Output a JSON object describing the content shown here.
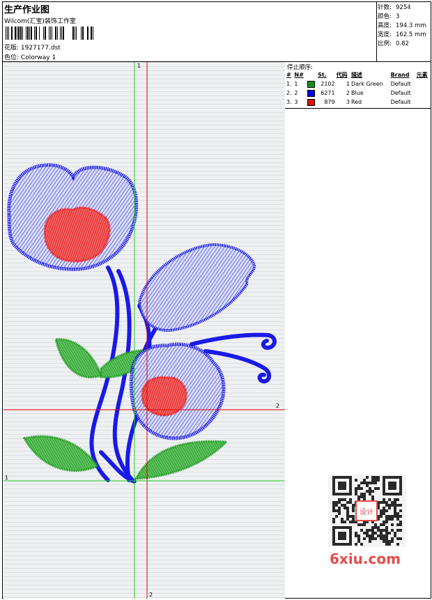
{
  "header": {
    "title": "生产作业图",
    "company": "Wilcom(汇宝)装饰工作室",
    "design_label": "花版:",
    "design_value": "1927177.dst",
    "colorway_label": "色位:",
    "colorway_value": "Colorway 1"
  },
  "stats": [
    {
      "label": "针数:",
      "value": "9254"
    },
    {
      "label": "颜色:",
      "value": "3"
    },
    {
      "label": "高度:",
      "value": "194.3 mm"
    },
    {
      "label": "宽度:",
      "value": "162.5 mm"
    },
    {
      "label": "比例:",
      "value": "0.82"
    }
  ],
  "guides": {
    "v1": "1",
    "v2": "2",
    "h1": "1",
    "h2": "2"
  },
  "stop_sequence": {
    "label": "停止顺序:",
    "headers": [
      "#",
      "N#",
      "St.",
      "代码",
      "描述",
      "Brand",
      "元素"
    ],
    "rows": [
      {
        "idx": "1.",
        "n": "1",
        "color": "#1a8c1a",
        "st": "2102",
        "code": "1",
        "desc": "Dark Green",
        "brand": "Default"
      },
      {
        "idx": "2.",
        "n": "2",
        "color": "#0000e0",
        "st": "6271",
        "code": "2",
        "desc": "Blue",
        "brand": "Default"
      },
      {
        "idx": "3.",
        "n": "3",
        "color": "#e01010",
        "st": "879",
        "code": "3",
        "desc": "Red",
        "brand": "Default"
      }
    ]
  },
  "colors": {
    "green": "#1f9a1f",
    "blue": "#1a1ae6",
    "red": "#ee2020",
    "guide_green": "#22cc22",
    "guide_red": "#e00000"
  },
  "watermark": {
    "badge": "设计",
    "brand": "6xiu.com"
  }
}
